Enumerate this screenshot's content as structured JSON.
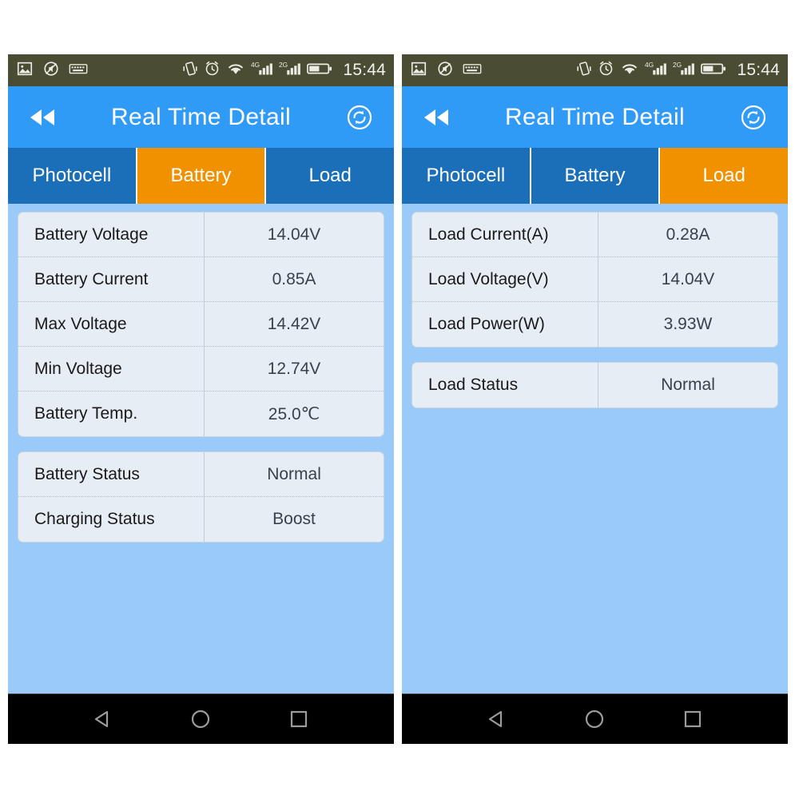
{
  "statusbar": {
    "left_icons": [
      "image-icon",
      "mute-circle-icon",
      "keyboard-icon"
    ],
    "right_icons": [
      "vibrate-icon",
      "alarm-icon",
      "wifi-icon",
      "signal-4g-icon",
      "signal-2g-icon",
      "battery-icon"
    ],
    "signal_4g_label": "4G",
    "signal_2g_label": "2G",
    "clock": "15:44"
  },
  "header": {
    "back_icon": "rewind-back-icon",
    "title": "Real Time Detail",
    "refresh_icon": "refresh-sync-icon"
  },
  "colors": {
    "statusbar_bg": "#4a4d33",
    "header_blue": "#2f9bf7",
    "tab_blue": "#1b6fb8",
    "tab_active_orange": "#f29100",
    "content_bg": "#9acafa",
    "card_bg": "#e6edf4",
    "navbar_bg": "#000000"
  },
  "navbar": {
    "back_label": "back-triangle-icon",
    "home_label": "home-circle-icon",
    "recents_label": "recents-square-icon"
  },
  "panels": [
    {
      "id": "battery-panel",
      "tabs": [
        {
          "label": "Photocell",
          "active": false
        },
        {
          "label": "Battery",
          "active": true
        },
        {
          "label": "Load",
          "active": false
        }
      ],
      "cards": [
        {
          "rows": [
            {
              "key": "Battery Voltage",
              "value": "14.04V"
            },
            {
              "key": "Battery Current",
              "value": "0.85A"
            },
            {
              "key": "Max Voltage",
              "value": "14.42V"
            },
            {
              "key": "Min Voltage",
              "value": "12.74V"
            },
            {
              "key": "Battery Temp.",
              "value": "25.0℃"
            }
          ]
        },
        {
          "rows": [
            {
              "key": "Battery Status",
              "value": "Normal"
            },
            {
              "key": "Charging Status",
              "value": "Boost"
            }
          ]
        }
      ]
    },
    {
      "id": "load-panel",
      "tabs": [
        {
          "label": "Photocell",
          "active": false
        },
        {
          "label": "Battery",
          "active": false
        },
        {
          "label": "Load",
          "active": true
        }
      ],
      "cards": [
        {
          "rows": [
            {
              "key": "Load Current(A)",
              "value": "0.28A"
            },
            {
              "key": "Load Voltage(V)",
              "value": "14.04V"
            },
            {
              "key": "Load Power(W)",
              "value": "3.93W"
            }
          ]
        },
        {
          "rows": [
            {
              "key": "Load Status",
              "value": "Normal"
            }
          ]
        }
      ]
    }
  ]
}
